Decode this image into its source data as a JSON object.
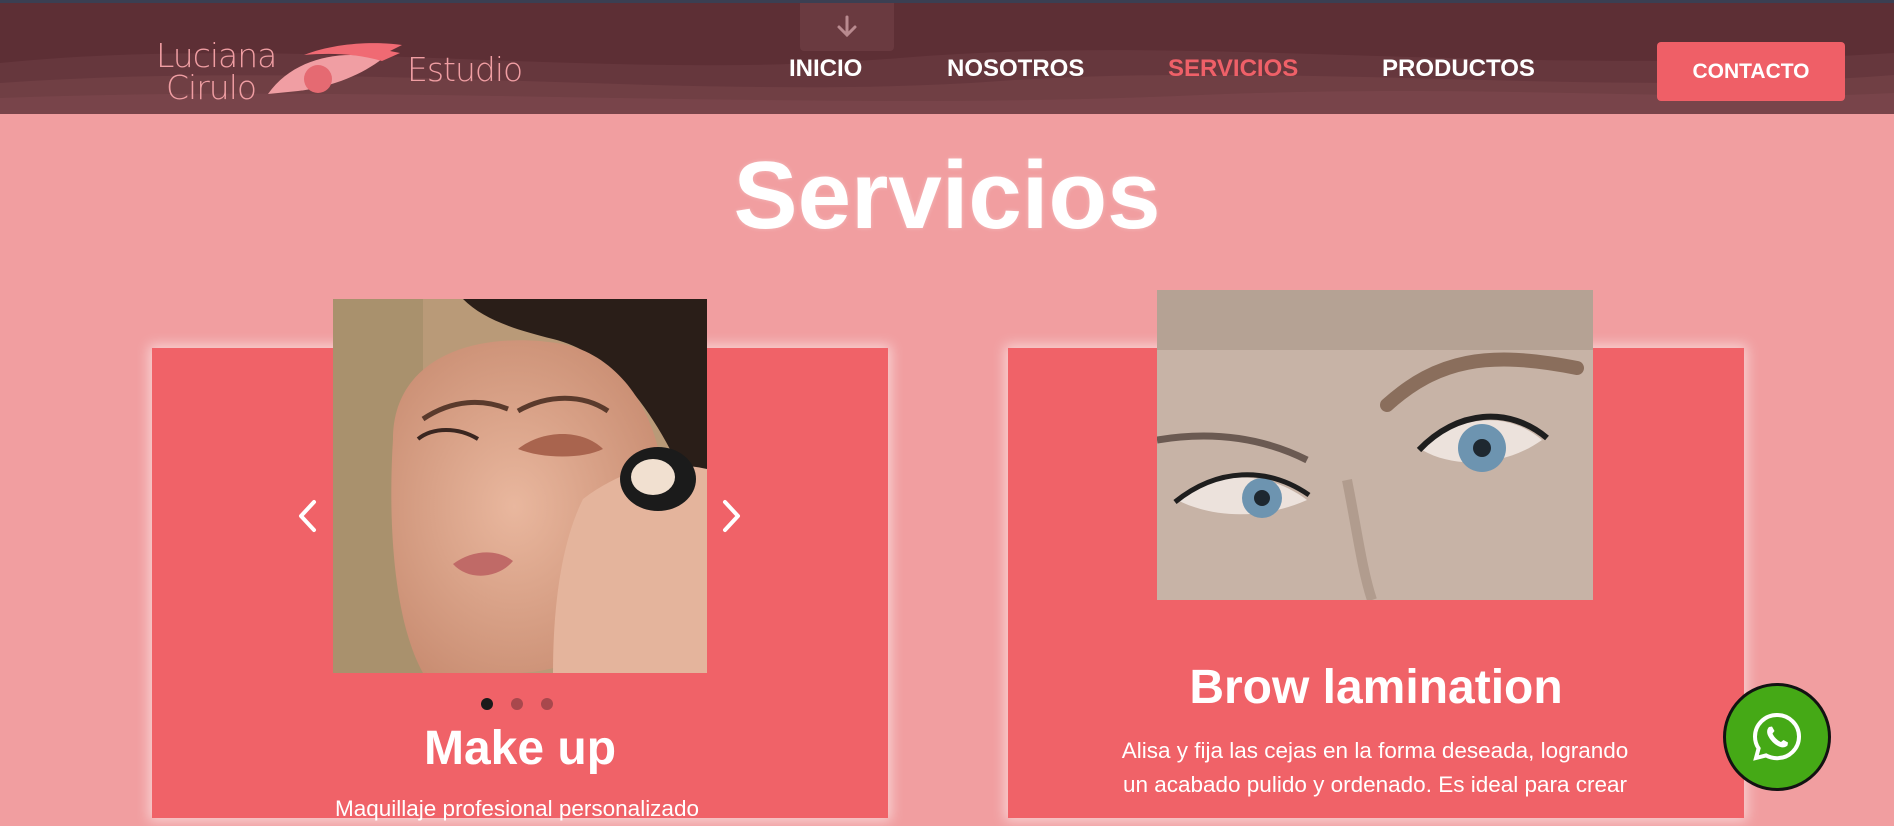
{
  "header": {
    "logo": {
      "line1": "Luciana",
      "line2": "Cirulo",
      "line3": "Estudio"
    },
    "nav": [
      {
        "label": "INICIO",
        "active": false
      },
      {
        "label": "NOSOTROS",
        "active": false
      },
      {
        "label": "SERVICIOS",
        "active": true
      },
      {
        "label": "PRODUCTOS",
        "active": false
      }
    ],
    "contact_label": "CONTACTO",
    "scroll_icon": "arrow-down-icon"
  },
  "main": {
    "title": "Servicios",
    "cards": [
      {
        "title": "Make up",
        "text": "Maquillaje profesional personalizado",
        "carousel": {
          "slides": 3,
          "active": 0,
          "prev_icon": "chevron-left-icon",
          "next_icon": "chevron-right-icon"
        }
      },
      {
        "title": "Brow lamination",
        "text_lines": [
          "Alisa y fija las cejas en la forma deseada, logrando",
          "un acabado pulido y ordenado. Es ideal para crear"
        ]
      }
    ]
  },
  "floating": {
    "icon": "whatsapp-icon"
  },
  "colors": {
    "page_bg": "#f19ea0",
    "header_bg": "#5d2f35",
    "accent": "#ef5f67",
    "card_bg": "#f06268",
    "whatsapp_green": "#45a916"
  }
}
